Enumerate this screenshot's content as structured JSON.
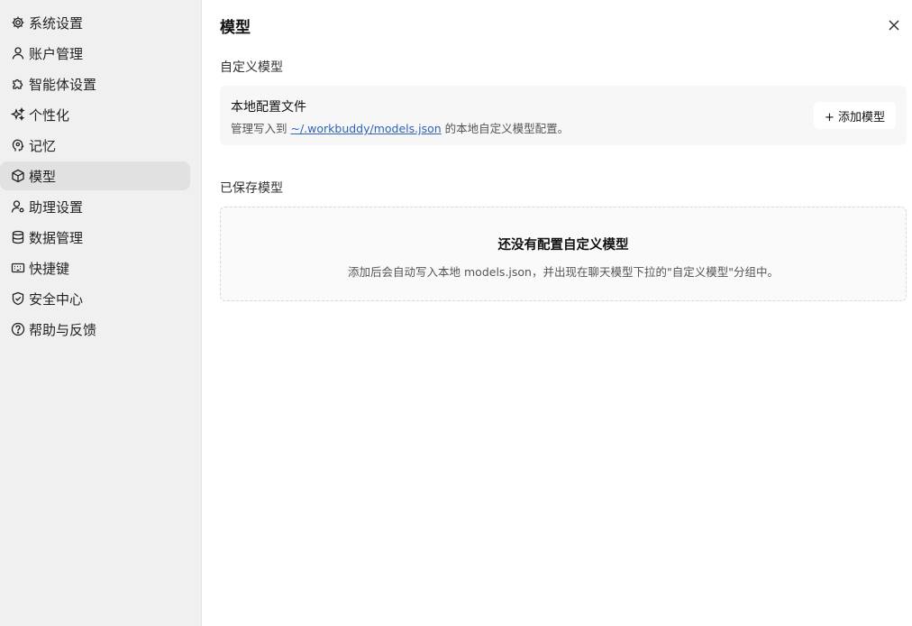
{
  "sidebar": {
    "items": [
      {
        "label": "系统设置",
        "icon": "gear-icon"
      },
      {
        "label": "账户管理",
        "icon": "user-icon"
      },
      {
        "label": "智能体设置",
        "icon": "puzzle-icon"
      },
      {
        "label": "个性化",
        "icon": "sparkle-icon"
      },
      {
        "label": "记忆",
        "icon": "head-icon"
      },
      {
        "label": "模型",
        "icon": "cube-icon",
        "active": true
      },
      {
        "label": "助理设置",
        "icon": "user-gear-icon"
      },
      {
        "label": "数据管理",
        "icon": "database-icon"
      },
      {
        "label": "快捷键",
        "icon": "keyboard-icon"
      },
      {
        "label": "安全中心",
        "icon": "shield-icon"
      },
      {
        "label": "帮助与反馈",
        "icon": "help-icon"
      }
    ]
  },
  "main": {
    "title": "模型",
    "custom_section": {
      "title": "自定义模型",
      "card_title": "本地配置文件",
      "desc_prefix": "管理写入到 ",
      "desc_link": "~/.workbuddy/models.json",
      "desc_suffix": " 的本地自定义模型配置。",
      "add_button": "+ 添加模型"
    },
    "saved_section": {
      "title": "已保存模型",
      "empty_title": "还没有配置自定义模型",
      "empty_desc": "添加后会自动写入本地 models.json，并出现在聊天模型下拉的\"自定义模型\"分组中。"
    }
  }
}
